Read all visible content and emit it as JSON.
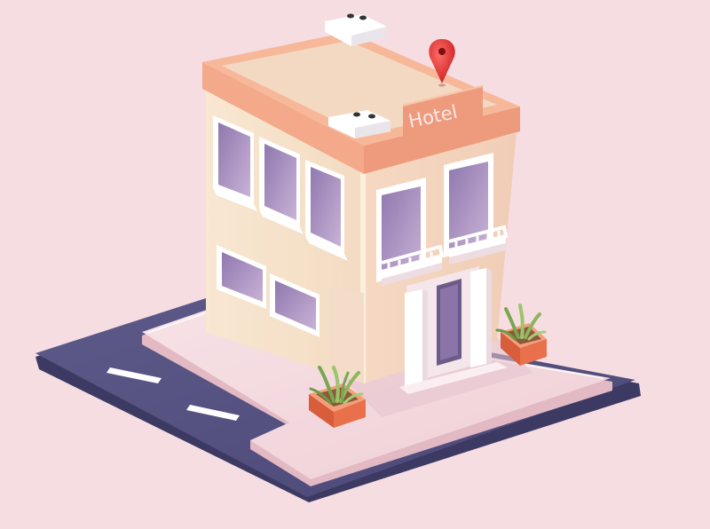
{
  "scene": {
    "sign_text": "Hotel",
    "colors": {
      "background": "#f6dde2",
      "road": "#54517e",
      "road_edge": "#3c3a63",
      "lane_marking": "#ffffff",
      "sidewalk": "#f0d2d8",
      "wall_light": "#f7e3cc",
      "wall_shadow": "#f1cdb2",
      "roof_rim": "#f3a98a",
      "roof_top": "#f4d9c2",
      "window_glass": "#b79ccb",
      "location_pin": "#e0302f",
      "planter": "#e8704a",
      "plant": "#8fb45d"
    }
  }
}
